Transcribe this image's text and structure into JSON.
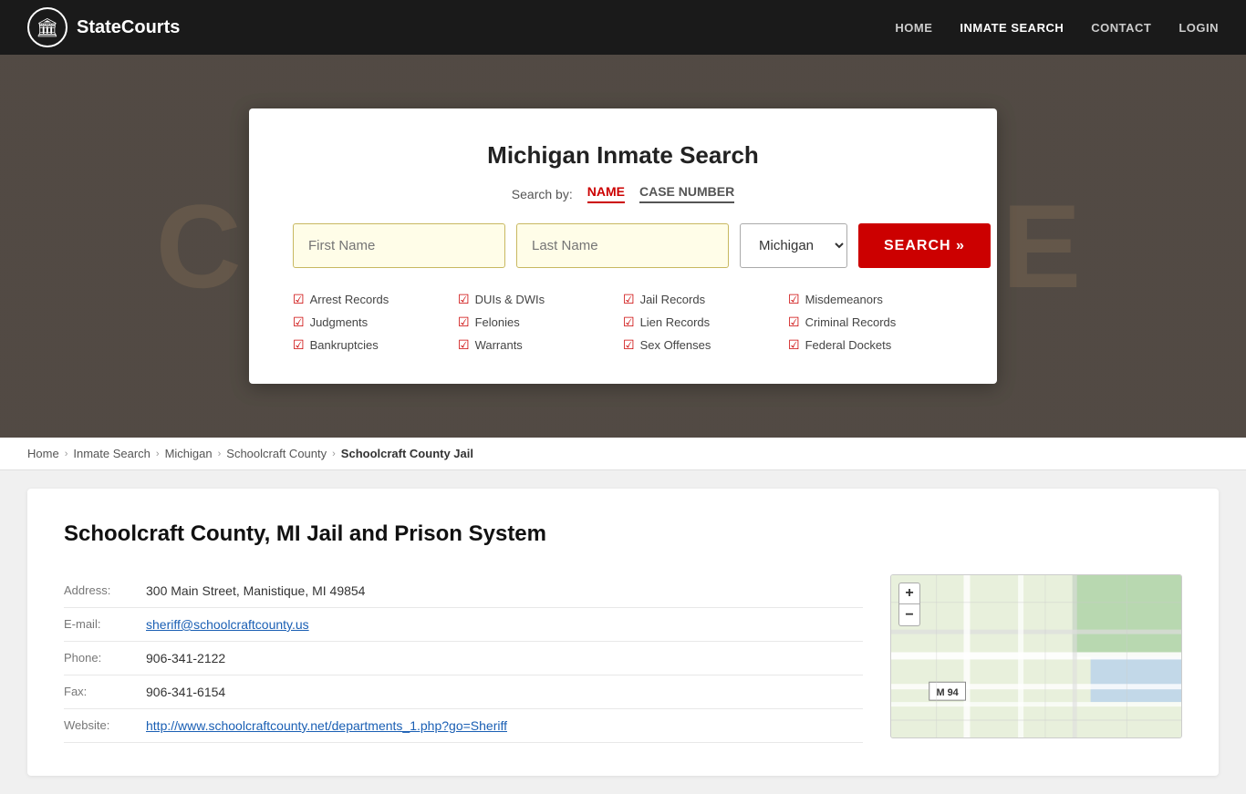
{
  "site": {
    "logo_icon": "🏛",
    "logo_text": "StateCourts"
  },
  "nav": {
    "links": [
      {
        "label": "HOME",
        "active": false
      },
      {
        "label": "INMATE SEARCH",
        "active": true
      },
      {
        "label": "CONTACT",
        "active": false
      },
      {
        "label": "LOGIN",
        "active": false
      }
    ]
  },
  "hero_bg_text": "COURTHOUSE",
  "search_card": {
    "title": "Michigan Inmate Search",
    "search_by_label": "Search by:",
    "tab_name": "NAME",
    "tab_case": "CASE NUMBER",
    "first_name_placeholder": "First Name",
    "last_name_placeholder": "Last Name",
    "state_value": "Michigan",
    "search_button": "SEARCH »",
    "checklist": [
      "Arrest Records",
      "DUIs & DWIs",
      "Jail Records",
      "Misdemeanors",
      "Judgments",
      "Felonies",
      "Lien Records",
      "Criminal Records",
      "Bankruptcies",
      "Warrants",
      "Sex Offenses",
      "Federal Dockets"
    ]
  },
  "breadcrumb": {
    "items": [
      {
        "label": "Home",
        "active": false
      },
      {
        "label": "Inmate Search",
        "active": false
      },
      {
        "label": "Michigan",
        "active": false
      },
      {
        "label": "Schoolcraft County",
        "active": false
      },
      {
        "label": "Schoolcraft County Jail",
        "active": true
      }
    ]
  },
  "content": {
    "title": "Schoolcraft County, MI Jail and Prison System",
    "address_label": "Address:",
    "address_value": "300 Main Street, Manistique, MI 49854",
    "email_label": "E-mail:",
    "email_value": "sheriff@schoolcraftcounty.us",
    "phone_label": "Phone:",
    "phone_value": "906-341-2122",
    "fax_label": "Fax:",
    "fax_value": "906-341-6154",
    "website_label": "Website:",
    "website_value": "http://www.schoolcraftcounty.net/departments_1.php?go=Sheriff"
  },
  "map": {
    "zoom_in": "+",
    "zoom_out": "−",
    "road_label": "M 94"
  }
}
